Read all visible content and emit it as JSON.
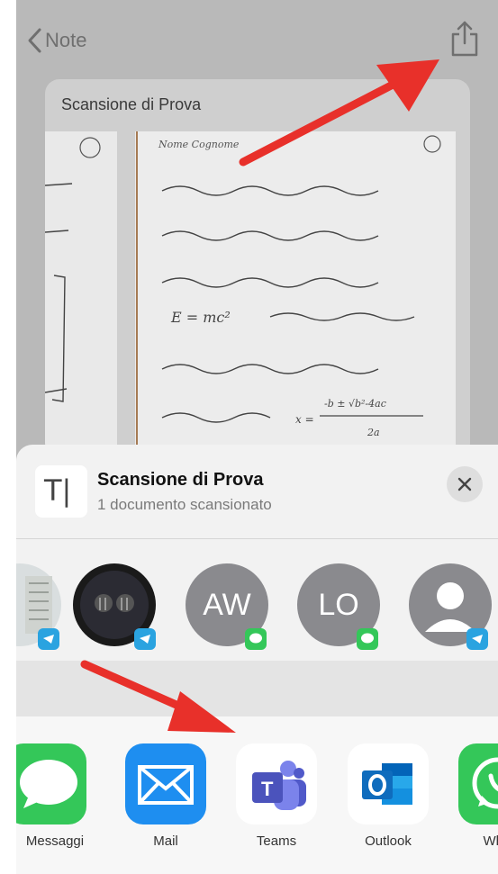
{
  "nav": {
    "back_label": "Note"
  },
  "preview": {
    "title": "Scansione di Prova"
  },
  "share_sheet": {
    "title": "Scansione di Prova",
    "subtitle": "1 documento scansionato",
    "contacts": [
      {
        "initials": "",
        "badge": "telegram"
      },
      {
        "initials": "",
        "badge": "telegram"
      },
      {
        "initials": "AW",
        "badge": "messages"
      },
      {
        "initials": "LO",
        "badge": "messages"
      },
      {
        "initials": "",
        "badge": "telegram"
      }
    ],
    "apps": [
      {
        "label": "Messaggi",
        "icon": "messages-icon"
      },
      {
        "label": "Mail",
        "icon": "mail-icon"
      },
      {
        "label": "Teams",
        "icon": "teams-icon"
      },
      {
        "label": "Outlook",
        "icon": "outlook-icon"
      },
      {
        "label": "What",
        "icon": "whatsapp-icon"
      }
    ]
  },
  "colors": {
    "messages_green": "#34c759",
    "mail_blue": "#1e8ef0",
    "teams_purple": "#5059c9",
    "outlook_blue": "#0f6cbd",
    "telegram_blue": "#2aa3e0",
    "arrow_red": "#e8302a"
  }
}
